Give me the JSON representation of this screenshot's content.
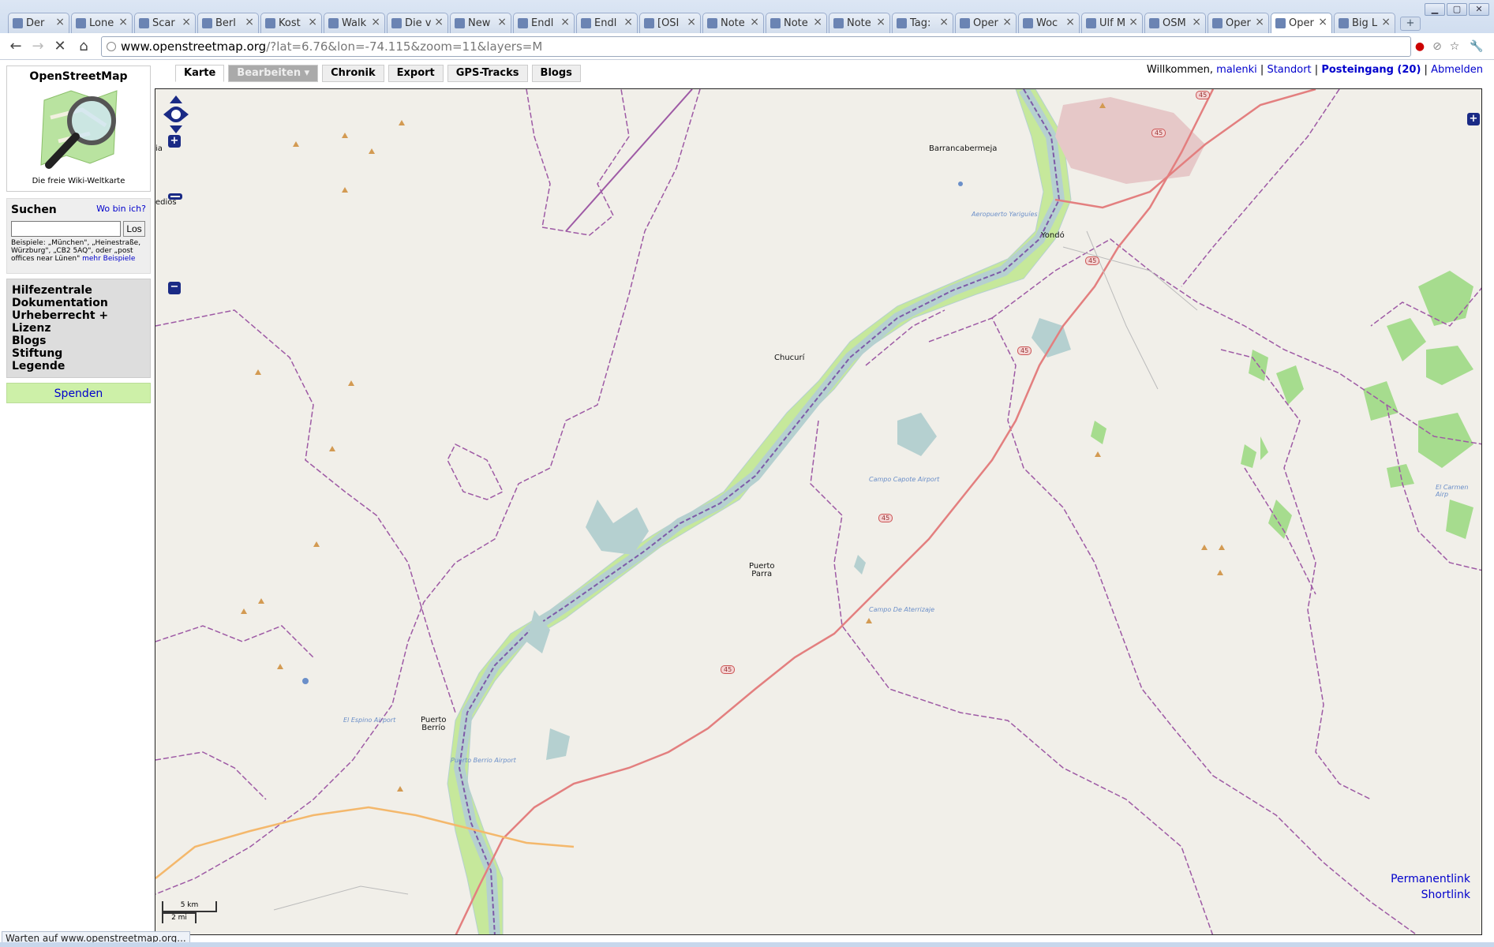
{
  "browser": {
    "tabs": [
      {
        "label": "Der"
      },
      {
        "label": "Lone"
      },
      {
        "label": "Scar"
      },
      {
        "label": "Berl"
      },
      {
        "label": "Kost"
      },
      {
        "label": "Walk"
      },
      {
        "label": "Die v"
      },
      {
        "label": "New"
      },
      {
        "label": "Endl"
      },
      {
        "label": "Endl"
      },
      {
        "label": "[OSI"
      },
      {
        "label": "Note"
      },
      {
        "label": "Note"
      },
      {
        "label": "Note"
      },
      {
        "label": "Tag:"
      },
      {
        "label": "Oper"
      },
      {
        "label": "Woc"
      },
      {
        "label": "Ulf M"
      },
      {
        "label": "OSM"
      },
      {
        "label": "Oper"
      },
      {
        "label": "Oper"
      },
      {
        "label": "Big L"
      }
    ],
    "active_tab_index": 20,
    "url_host": "www.openstreetmap.org",
    "url_rest": "/?lat=6.76&lon=-74.115&zoom=11&layers=M",
    "status": "Warten auf www.openstreetmap.org..."
  },
  "sidebar": {
    "title": "OpenStreetMap",
    "subtitle": "Die freie Wiki-Weltkarte",
    "search_label": "Suchen",
    "where_am_i": "Wo bin ich?",
    "search_value": "",
    "search_button": "Los",
    "search_hint": "Beispiele: „München\", „Heinestraße, Würzburg\", „CB2 5AQ\", oder „post offices near Lünen\"",
    "more_examples": "mehr Beispiele",
    "links": [
      "Hilfezentrale",
      "Dokumentation",
      "Urheberrecht + Lizenz",
      "Blogs",
      "Stiftung",
      "Legende"
    ],
    "donate": "Spenden"
  },
  "nav_tabs": {
    "karte": "Karte",
    "bearbeiten": "Bearbeiten ▾",
    "chronik": "Chronik",
    "export": "Export",
    "gps": "GPS-Tracks",
    "blogs": "Blogs"
  },
  "user_bar": {
    "welcome": "Willkommen,",
    "user": "malenki",
    "standort": "Standort",
    "inbox": "Posteingang (20)",
    "logout": "Abmelden",
    "sep": "|"
  },
  "map": {
    "places": {
      "barranca": "Barrancabermeja",
      "yondo": "Yondó",
      "chucuri": "Chucurí",
      "puerto_parra_1": "Puerto",
      "puerto_parra_2": "Parra",
      "puerto_berrio_1": "Puerto",
      "puerto_berrio_2": "Berrío",
      "remedios": "edios",
      "left_edge": "ia"
    },
    "airports": {
      "yariguies": "Aeropuerto Yariguíes",
      "capote": "Campo Capote Airport",
      "aterrizaje": "Campo De Aterrizaje",
      "espino": "El Espino Airport",
      "berrio": "Puerto Berrio Airport",
      "carmen": "El Carmen Airp"
    },
    "road_shield": "45",
    "scale_km": "5 km",
    "scale_mi": "2 mi",
    "permalink": "Permanentlink",
    "shortlink": "Shortlink"
  },
  "colors": {
    "map_background": "#f1efe9",
    "river": "#b5d0d0",
    "wetland": "#c6e89b",
    "road_primary": "#e37f7f",
    "road_secondary": "#f4b86c",
    "boundary": "#9e5aa5",
    "forest": "#9fd88a",
    "link": "#0000cc"
  }
}
